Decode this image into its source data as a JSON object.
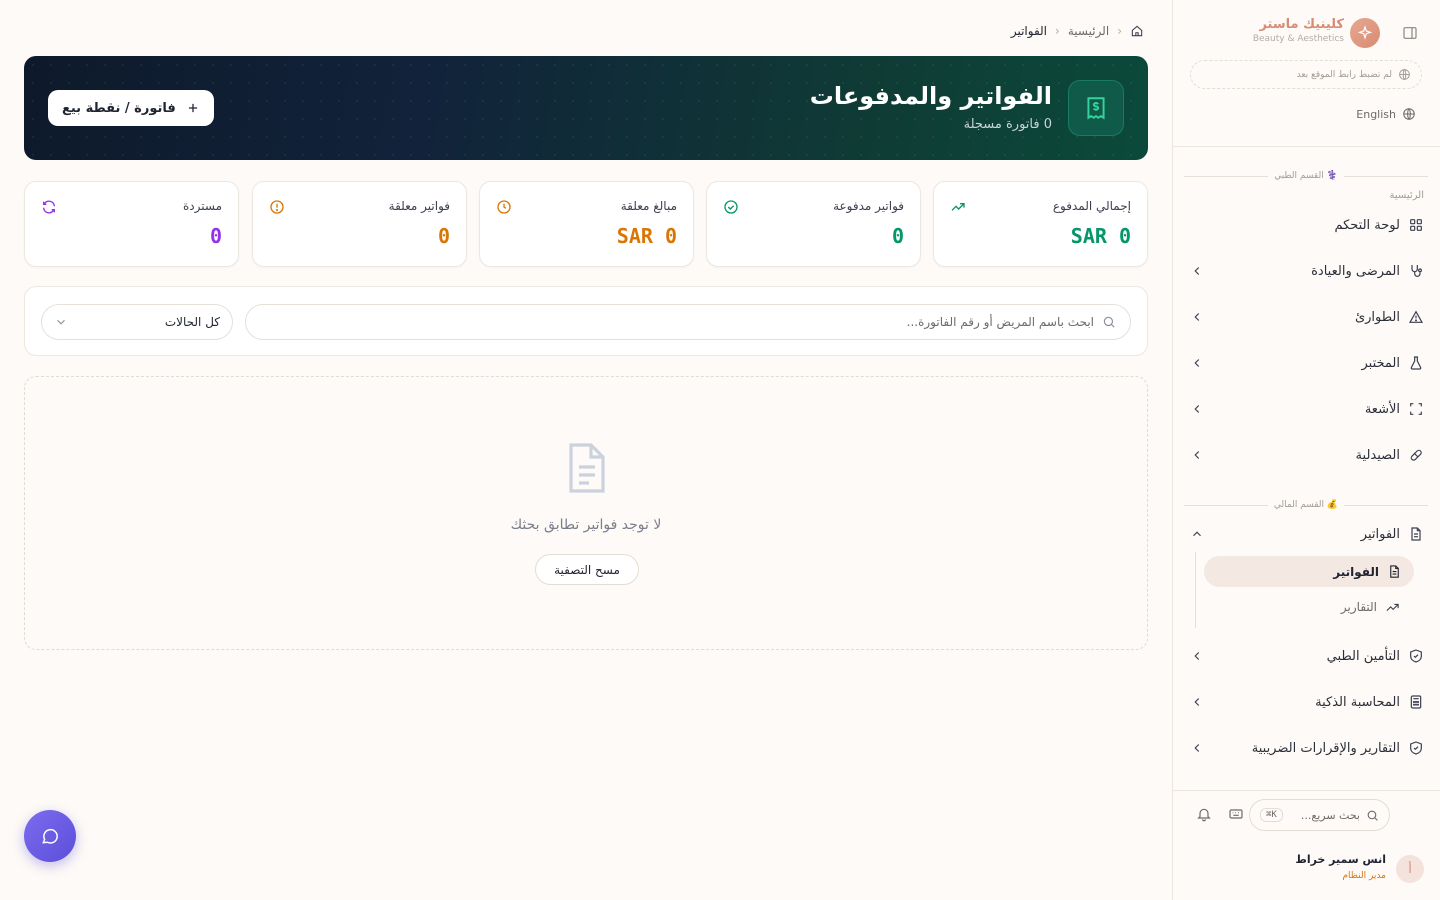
{
  "sidebar": {
    "brand_name": "كلينيك ماستر",
    "brand_sub": "Beauty & Aesthetics",
    "site_link_text": "لم تضبط رابط الموقع بعد",
    "language_label": "English",
    "medical_section_title": "⚕️ القسم الطبي",
    "home_heading": "الرئيسية",
    "items": [
      {
        "label": "لوحة التحكم",
        "icon": "dashboard-icon"
      },
      {
        "label": "المرضى والعيادة",
        "icon": "stethoscope-icon"
      },
      {
        "label": "الطوارئ",
        "icon": "alert-triangle-icon"
      },
      {
        "label": "المختبر",
        "icon": "flask-icon"
      },
      {
        "label": "الأشعة",
        "icon": "scan-icon"
      },
      {
        "label": "الصيدلية",
        "icon": "pill-icon"
      }
    ],
    "finance_section_title": "💰 القسم المالي",
    "invoices_group": {
      "label": "الفواتير",
      "children": [
        {
          "label": "الفواتير",
          "active": true
        },
        {
          "label": "التقارير",
          "active": false
        }
      ]
    },
    "finance_items": [
      {
        "label": "التأمين الطبي",
        "icon": "shield-icon"
      },
      {
        "label": "المحاسبة الذكية",
        "icon": "calculator-icon"
      },
      {
        "label": "التقارير والإقرارات الضريبية",
        "icon": "shield-check-icon"
      }
    ],
    "quick_search_placeholder": "بحث سريع...",
    "shortcut": "⌘K",
    "user": {
      "initial": "أ",
      "name": "انس سمير خراط",
      "role": "مدير النظام"
    }
  },
  "breadcrumb": {
    "home": "الرئيسية",
    "current": "الفواتير"
  },
  "hero": {
    "title": "الفواتير والمدفوعات",
    "subtitle": "0 فاتورة مسجلة",
    "new_button": "فاتورة / نقطة بيع"
  },
  "stats": [
    {
      "label": "إجمالي المدفوع",
      "value": "SAR 0",
      "color": "#059669",
      "icon": "trending-up-icon"
    },
    {
      "label": "فواتير مدفوعة",
      "value": "0",
      "color": "#059669",
      "icon": "check-circle-icon"
    },
    {
      "label": "مبالغ معلقة",
      "value": "SAR 0",
      "color": "#d97706",
      "icon": "clock-icon"
    },
    {
      "label": "فواتير معلقة",
      "value": "0",
      "color": "#d97706",
      "icon": "alert-circle-icon"
    },
    {
      "label": "مستردة",
      "value": "0",
      "color": "#9333ea",
      "icon": "refresh-icon"
    }
  ],
  "filters": {
    "search_placeholder": "ابحث باسم المريض أو رقم الفاتورة...",
    "status_value": "كل الحالات"
  },
  "empty_state": {
    "message": "لا توجد فواتير تطابق بحثك",
    "clear_button": "مسح التصفية"
  },
  "colors": {
    "accent": "#d98b73",
    "success": "#059669",
    "warning": "#d97706",
    "purple": "#9333ea",
    "fab": "#6b5ce7"
  }
}
